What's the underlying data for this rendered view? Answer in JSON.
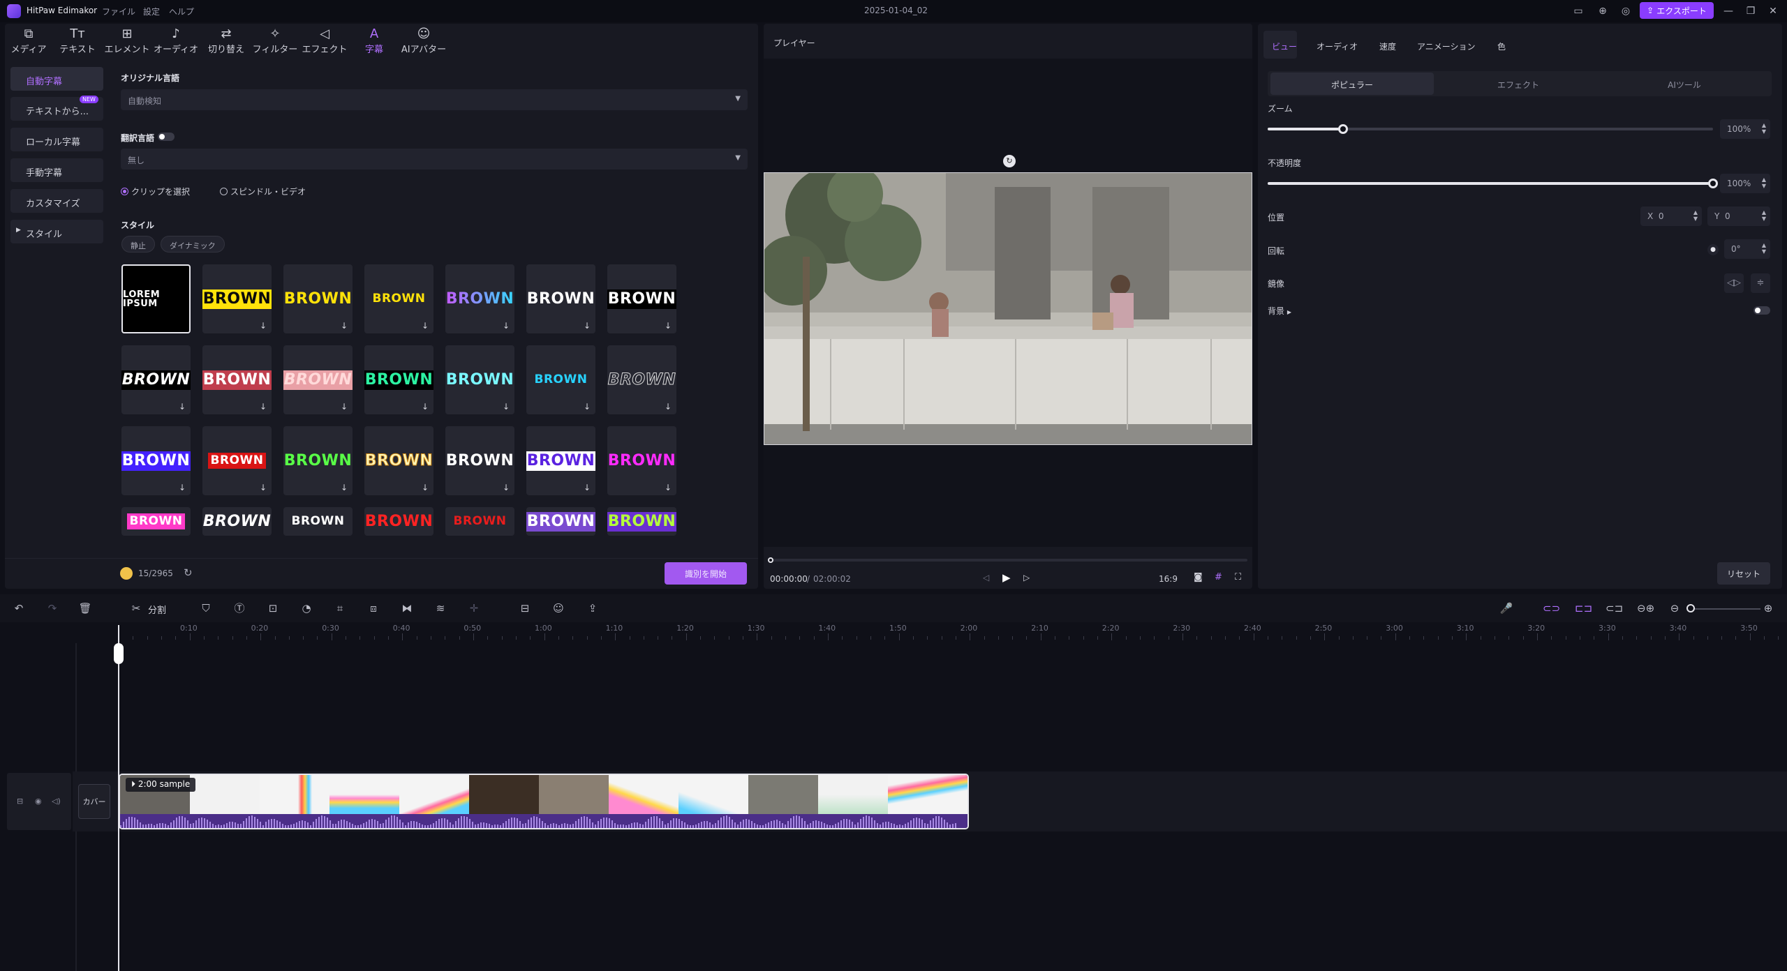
{
  "titlebar": {
    "app_name": "HitPaw Edimakor",
    "menus": [
      "ファイル",
      "設定",
      "ヘルプ"
    ],
    "document": "2025-01-04_02",
    "export_label": "エクスポート"
  },
  "toolbar": {
    "tools": [
      "メディア",
      "テキスト",
      "エレメント",
      "オーディオ",
      "切り替え",
      "フィルター",
      "エフェクト",
      "字幕",
      "AIアバター"
    ],
    "active": "字幕"
  },
  "subtitle_menu": {
    "items": [
      "自動字幕",
      "テキストから...",
      "ローカル字幕",
      "手動字幕",
      "カスタマイズ",
      "スタイル"
    ],
    "new_badge": "NEW"
  },
  "auto_caption": {
    "original_language_label": "オリジナル言語",
    "original_language_value": "自動検知",
    "translate_label": "翻訳言語",
    "translate_value": "無し",
    "radio_clip": "クリップを選択",
    "radio_spindle": "スピンドル・ビデオ",
    "style_label": "スタイル",
    "chips": [
      "静止",
      "ダイナミック"
    ],
    "first_style_text": "LOREM IPSUM",
    "sample_text": "BROWN",
    "credits": "15/2965",
    "start_button": "識別を開始"
  },
  "player": {
    "title": "プレイヤー",
    "time_current": "00:00:00",
    "time_total": "02:00:02",
    "aspect": "16:9"
  },
  "properties": {
    "tabs": [
      "ビュー",
      "オーディオ",
      "速度",
      "アニメーション",
      "色"
    ],
    "subtabs": [
      "ポピュラー",
      "エフェクト",
      "AIツール"
    ],
    "zoom_label": "ズーム",
    "zoom_value": "100%",
    "zoom_level": 0.17,
    "opacity_label": "不透明度",
    "opacity_value": "100%",
    "opacity_level": 1.0,
    "position_label": "位置",
    "x_label": "X",
    "x_value": "0",
    "y_label": "Y",
    "y_value": "0",
    "rotation_label": "回転",
    "rotation_value": "0°",
    "mirror_label": "鏡像",
    "background_label": "背景",
    "reset_label": "リセット"
  },
  "timeline": {
    "split_label": "分割",
    "ruler": [
      "0:10",
      "0:20",
      "0:30",
      "0:40",
      "0:50",
      "1:00",
      "1:10",
      "1:20",
      "1:30",
      "1:40",
      "1:50",
      "2:00",
      "2:10",
      "2:20",
      "2:30",
      "2:40",
      "2:50",
      "3:00",
      "3:10",
      "3:20",
      "3:30",
      "3:40",
      "3:50"
    ],
    "cover_label": "カバー",
    "clip_name": "2:00 sample"
  }
}
